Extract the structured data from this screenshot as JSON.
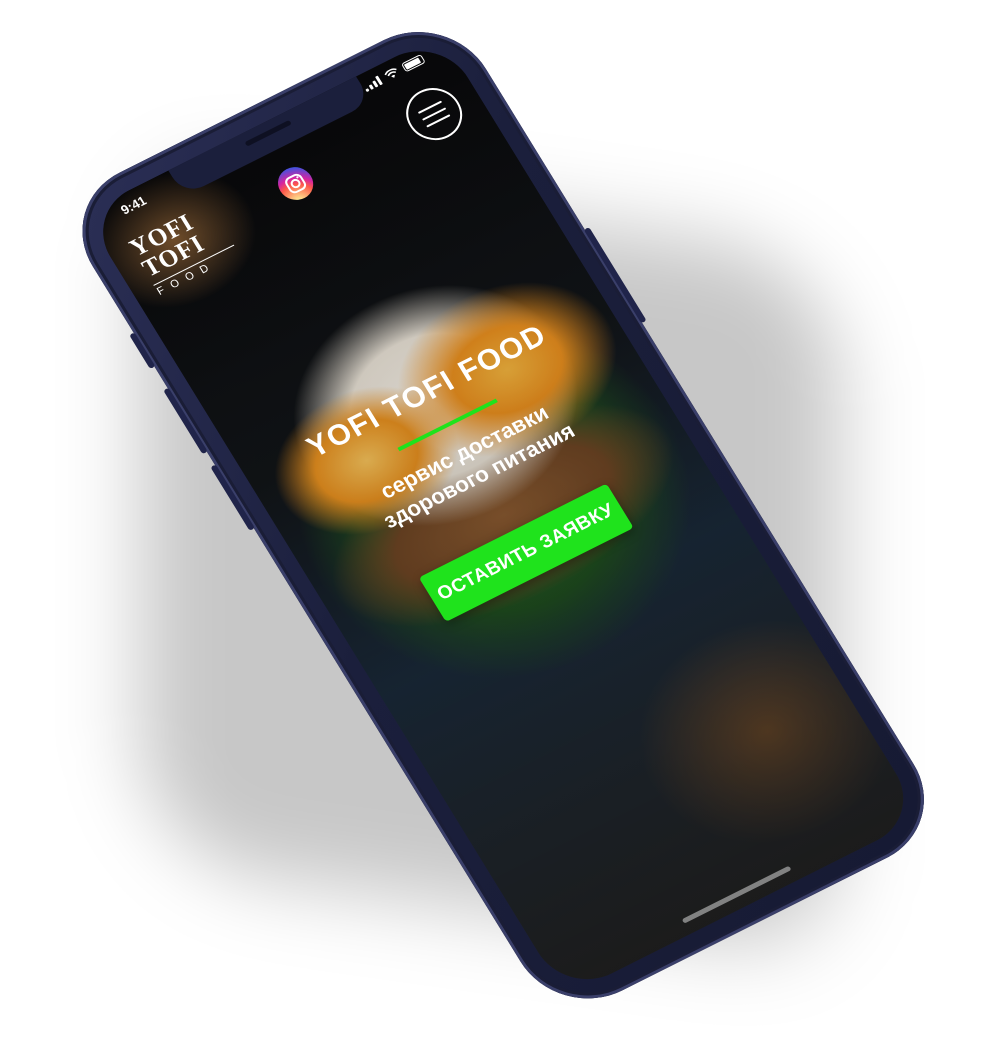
{
  "status_bar": {
    "time": "9:41"
  },
  "brand": {
    "logo_line1": "YOFI",
    "logo_line2": "TOFI",
    "logo_line3": "FOOD"
  },
  "header": {
    "instagram_icon": "instagram-icon",
    "menu_icon": "hamburger-menu-icon"
  },
  "hero": {
    "title": "YOFI TOFI FOOD",
    "subtitle_line1": "сервис доставки",
    "subtitle_line2": "здорового питания",
    "cta_label": "ОСТАВИТЬ ЗАЯВКУ"
  },
  "colors": {
    "accent": "#1fe31c",
    "phone_frame": "#1b1f3c",
    "text": "#ffffff"
  }
}
